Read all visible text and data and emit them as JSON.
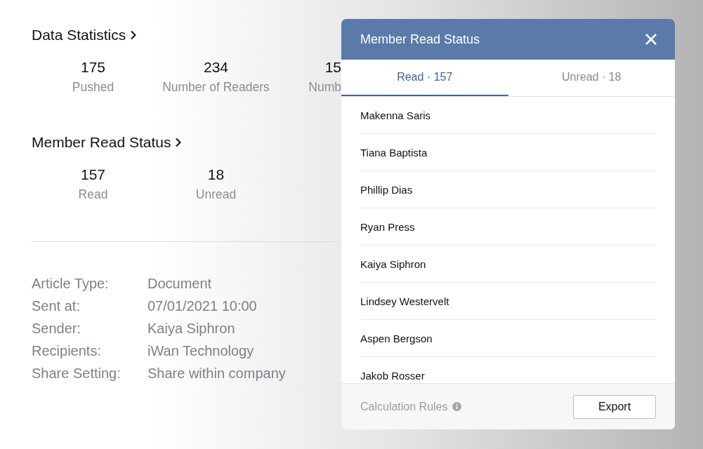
{
  "sections": [
    {
      "title": "Data Statistics",
      "stats": [
        {
          "value": "175",
          "label": "Pushed",
          "kind": "full"
        },
        {
          "value": "234",
          "label": "Number of Readers",
          "kind": "full"
        },
        {
          "value": "15",
          "label": "Numb",
          "kind": "clipped"
        }
      ]
    },
    {
      "title": "Member Read Status",
      "stats": [
        {
          "value": "157",
          "label": "Read",
          "kind": "full"
        },
        {
          "value": "18",
          "label": "Unread",
          "kind": "full"
        }
      ]
    }
  ],
  "details": [
    {
      "label": "Article Type:",
      "value": "Document"
    },
    {
      "label": "Sent at:",
      "value": "07/01/2021 10:00"
    },
    {
      "label": "Sender:",
      "value": "Kaiya Siphron"
    },
    {
      "label": "Recipients:",
      "value": "iWan Technology"
    },
    {
      "label": "Share Setting:",
      "value": "Share within company"
    }
  ],
  "dialog": {
    "title": "Member Read Status",
    "tabs": [
      {
        "label": "Read · 157",
        "selected": true
      },
      {
        "label": "Unread · 18",
        "selected": false
      }
    ],
    "members": [
      "Makenna Saris",
      "Tiana Baptista",
      "Phillip Dias",
      "Ryan Press",
      "Kaiya Siphron",
      "Lindsey Westervelt",
      "Aspen Bergson",
      "Jakob Rosser"
    ],
    "footer_link": "Calculation Rules",
    "export_button": "Export"
  }
}
